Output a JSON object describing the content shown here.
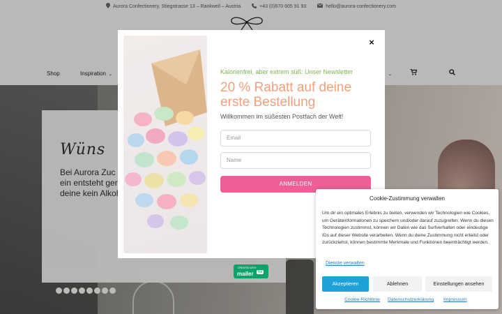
{
  "topbar": {
    "address": "Aurora Confectionery, Stiegstrasse 13 – Rankweil – Austria",
    "phone": "+43 (0)670 605 91 93",
    "email": "hello@aurora-confectionery.com"
  },
  "nav": {
    "items": [
      "Shop",
      "Inspiration"
    ]
  },
  "hero": {
    "card_title": "Wüns",
    "card_text": "Bei Aurora Zuc schung ganz na von deiner Hoc Thema oder ein entsteht genau Wir bieten auß nussfreie Sorte wir auch deine kein Alkohol? K"
  },
  "modal": {
    "close": "×",
    "kicker": "Kalorienfrei, aber extrem süß: Unser Newsletter",
    "title": "20 % Rabatt auf deine erste Bestellung",
    "subtitle": "Willkommen im süßesten Postfach der Welt!",
    "email_placeholder": "Email",
    "name_placeholder": "Name",
    "submit": "ANMELDEN",
    "badge_top": "CREATED WITH",
    "badge_brand": "mailer",
    "badge_lite": "lite"
  },
  "cookie": {
    "title": "Cookie-Zustimmung verwalten",
    "text": "Um dir ein optimales Erlebnis zu bieten, verwenden wir Technologien wie Cookies, um Geräteinformationen zu speichern und/oder darauf zuzugreifen. Wenn du diesen Technologien zustimmst, können wir Daten wie das Surfverhalten oder eindeutige IDs auf dieser Website verarbeiten. Wenn du deine Zustimmung nicht erteilst oder zurückziehst, können bestimmte Merkmale und Funktionen beeinträchtigt werden.",
    "services_link": "Dienste verwalten",
    "accept": "Akzeptieren",
    "deny": "Ablehnen",
    "preferences": "Einstellungen ansehen",
    "links": [
      "Cookie-Richtlinie",
      "Datenschutzerklärung",
      "Impressum"
    ]
  },
  "colors": {
    "accent_pink": "#ef5f97",
    "title_orange": "#f3a07a",
    "kicker_green": "#7bb54a",
    "cookie_blue": "#1da1d6"
  }
}
